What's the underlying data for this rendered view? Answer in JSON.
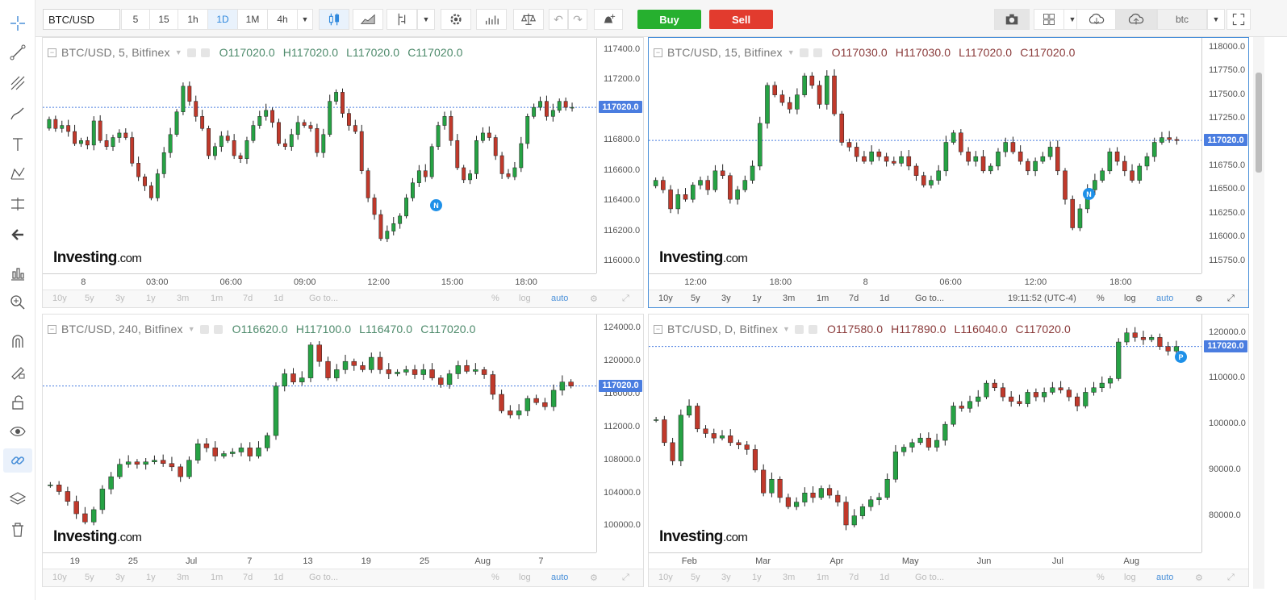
{
  "toolbar": {
    "symbol": "BTC/USD",
    "intervals": [
      "5",
      "15",
      "1h",
      "1D",
      "1M",
      "4h"
    ],
    "active_interval": "1D",
    "buy_label": "Buy",
    "sell_label": "Sell",
    "save_text": "btc"
  },
  "left_tools": [
    "crosshair-icon",
    "trend-line-icon",
    "fib-icon",
    "brush-icon",
    "text-icon",
    "pattern-icon",
    "measure-icon",
    "back-arrow-icon",
    "indicator-icon",
    "zoom-icon",
    "magnet-icon",
    "lock-draw-icon",
    "unlock-icon",
    "eye-icon",
    "link-icon",
    "layers-icon",
    "trash-icon"
  ],
  "footer_items": [
    "10y",
    "5y",
    "3y",
    "1y",
    "3m",
    "1m",
    "7d",
    "1d",
    "Go to..."
  ],
  "footer_right": [
    "%",
    "log",
    "auto"
  ],
  "watermark": {
    "brand": "Investing",
    "suffix": ".com"
  },
  "colors": {
    "up": "#26a244",
    "down": "#c0392b",
    "accent": "#4a7de0",
    "buy": "#26b02f",
    "sell": "#e23b2e"
  },
  "panes": [
    {
      "title": "BTC/USD, 5, Bitfinex",
      "ohlc": {
        "o": "O117020.0",
        "h": "H117020.0",
        "l": "L117020.0",
        "c": "C117020.0"
      },
      "ohlc_dir": "up",
      "y_ticks": [
        "117400.0",
        "117200.0",
        "117000.0",
        "116800.0",
        "116600.0",
        "116400.0",
        "116200.0",
        "116000.0"
      ],
      "last_price": "117020.0",
      "x_ticks": [
        "8",
        "03:00",
        "06:00",
        "09:00",
        "12:00",
        "15:00",
        "18:00"
      ],
      "marker": "N",
      "time": "",
      "chart_data": {
        "type": "candlestick",
        "ylim": [
          115920,
          117480
        ],
        "last": 117020,
        "closes": [
          116940,
          116880,
          116900,
          116860,
          116780,
          116800,
          116770,
          116930,
          116800,
          116760,
          116820,
          116850,
          116820,
          116650,
          116560,
          116500,
          116420,
          116580,
          116720,
          116840,
          116990,
          117160,
          117060,
          116960,
          116880,
          116700,
          116760,
          116830,
          116800,
          116700,
          116680,
          116800,
          116900,
          116960,
          117000,
          116920,
          116780,
          116760,
          116840,
          116920,
          116900,
          116880,
          116720,
          116840,
          117060,
          117120,
          116980,
          116900,
          116860,
          116600,
          116420,
          116310,
          116150,
          116200,
          116250,
          116300,
          116420,
          116520,
          116600,
          116560,
          116760,
          116900,
          116960,
          116800,
          116620,
          116540,
          116580,
          116800,
          116850,
          116820,
          116700,
          116580,
          116560,
          116620,
          116780,
          116960,
          117020,
          117060,
          116960,
          117000,
          117060,
          117020,
          117020
        ]
      }
    },
    {
      "title": "BTC/USD, 15, Bitfinex",
      "ohlc": {
        "o": "O117030.0",
        "h": "H117030.0",
        "l": "L117020.0",
        "c": "C117020.0"
      },
      "ohlc_dir": "down",
      "y_ticks": [
        "118000.0",
        "117750.0",
        "117500.0",
        "117250.0",
        "117000.0",
        "116750.0",
        "116500.0",
        "116250.0",
        "116000.0",
        "115750.0"
      ],
      "last_price": "117020.0",
      "x_ticks": [
        "12:00",
        "18:00",
        "8",
        "06:00",
        "12:00",
        "18:00"
      ],
      "marker": "N",
      "time": "19:11:52 (UTC-4)",
      "chart_data": {
        "type": "candlestick",
        "ylim": [
          115620,
          118100
        ],
        "last": 117020,
        "closes": [
          116600,
          116500,
          116300,
          116450,
          116400,
          116550,
          116600,
          116500,
          116700,
          116650,
          116400,
          116500,
          116600,
          116750,
          117200,
          117600,
          117500,
          117420,
          117350,
          117500,
          117700,
          117600,
          117400,
          117700,
          117300,
          117000,
          116950,
          116850,
          116800,
          116900,
          116850,
          116800,
          116780,
          116850,
          116750,
          116650,
          116550,
          116600,
          116700,
          117000,
          117100,
          116900,
          116800,
          116850,
          116700,
          116750,
          116900,
          117000,
          116900,
          116800,
          116700,
          116800,
          116850,
          116950,
          116700,
          116400,
          116100,
          116300,
          116500,
          116600,
          116700,
          116900,
          116800,
          116700,
          116600,
          116750,
          116850,
          117000,
          117050,
          117030,
          117020
        ]
      }
    },
    {
      "title": "BTC/USD, 240, Bitfinex",
      "ohlc": {
        "o": "O116620.0",
        "h": "H117100.0",
        "l": "L116470.0",
        "c": "C117020.0"
      },
      "ohlc_dir": "up",
      "y_ticks": [
        "124000.0",
        "120000.0",
        "116000.0",
        "112000.0",
        "108000.0",
        "104000.0",
        "100000.0"
      ],
      "last_price": "117020.0",
      "x_ticks": [
        "19",
        "25",
        "Jul",
        "7",
        "13",
        "19",
        "25",
        "Aug",
        "7"
      ],
      "marker": "",
      "time": "",
      "chart_data": {
        "type": "candlestick",
        "ylim": [
          96800,
          125700
        ],
        "last": 117020,
        "closes": [
          105000,
          104200,
          103000,
          101500,
          100500,
          102000,
          104500,
          106000,
          107500,
          107800,
          107500,
          107800,
          108000,
          107600,
          107200,
          106000,
          108000,
          110000,
          109500,
          108500,
          108800,
          109000,
          109500,
          108500,
          109500,
          111000,
          117000,
          118500,
          117500,
          118000,
          122000,
          120000,
          118000,
          119000,
          120000,
          119500,
          119000,
          120500,
          119000,
          118500,
          118700,
          119000,
          118400,
          119000,
          118000,
          117200,
          118500,
          119500,
          118800,
          119000,
          118400,
          116000,
          114000,
          113500,
          114000,
          115500,
          115000,
          114500,
          116500,
          117500,
          117020
        ]
      }
    },
    {
      "title": "BTC/USD, D, Bitfinex",
      "ohlc": {
        "o": "O117580.0",
        "h": "H117890.0",
        "l": "L116040.0",
        "c": "C117020.0"
      },
      "ohlc_dir": "down",
      "y_ticks": [
        "120000.0",
        "110000.0",
        "100000.0",
        "90000.0",
        "80000.0"
      ],
      "last_price": "117020.0",
      "x_ticks": [
        "Feb",
        "Mar",
        "Apr",
        "May",
        "Jun",
        "Jul",
        "Aug"
      ],
      "marker": "P",
      "time": "",
      "chart_data": {
        "type": "candlestick",
        "ylim": [
          72000,
          124000
        ],
        "last": 117020,
        "closes": [
          101000,
          96000,
          92000,
          102000,
          104000,
          99000,
          98000,
          97000,
          97500,
          96000,
          95500,
          94500,
          90000,
          85000,
          88000,
          84000,
          82000,
          83000,
          85000,
          84000,
          86000,
          84500,
          83000,
          78000,
          80000,
          82000,
          83500,
          84000,
          88000,
          94000,
          95000,
          96000,
          97000,
          95000,
          96500,
          100000,
          104000,
          103500,
          105000,
          106000,
          109000,
          108000,
          106000,
          105000,
          104500,
          107000,
          106000,
          107000,
          108000,
          107500,
          106000,
          104000,
          107000,
          108000,
          109000,
          110000,
          118000,
          120000,
          119000,
          118500,
          119000,
          117000,
          116000,
          117020
        ]
      }
    }
  ]
}
